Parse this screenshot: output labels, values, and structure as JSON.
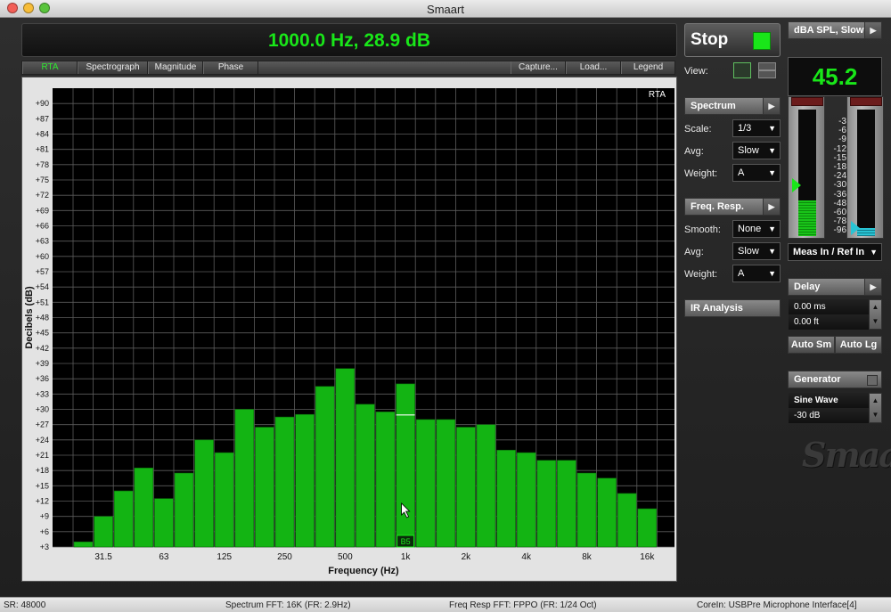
{
  "window": {
    "title": "Smaart"
  },
  "readout": {
    "text": "1000.0 Hz, 28.9 dB"
  },
  "tabs": {
    "rta": "RTA",
    "spectrograph": "Spectrograph",
    "magnitude": "Magnitude",
    "phase": "Phase",
    "capture": "Capture...",
    "load": "Load...",
    "legend": "Legend"
  },
  "plot": {
    "corner_label": "RTA",
    "cursor_label": "B5"
  },
  "controls": {
    "stop_label": "Stop",
    "view_label": "View:",
    "spectrum_header": "Spectrum",
    "scale_label": "Scale:",
    "scale_value": "1/3",
    "avg_label": "Avg:",
    "avg_value": "Slow",
    "weight_label": "Weight:",
    "weight_value": "A",
    "freq_header": "Freq. Resp.",
    "smooth_label": "Smooth:",
    "smooth_value": "None",
    "fr_avg_label": "Avg:",
    "fr_avg_value": "Slow",
    "fr_weight_label": "Weight:",
    "fr_weight_value": "A",
    "ir_label": "IR Analysis"
  },
  "spl": {
    "header": "dBA SPL, Slow",
    "value": "45.2"
  },
  "meter": {
    "scale": [
      "-3",
      "-6",
      "-9",
      "-12",
      "-15",
      "-18",
      "-24",
      "-30",
      "-36",
      "-48",
      "-60",
      "-78",
      "-96"
    ],
    "input_select": "Meas In / Ref In",
    "meas_level": 0.28,
    "ref_level": 0.06
  },
  "delay": {
    "header": "Delay",
    "ms": "0.00 ms",
    "ft": "0.00 ft",
    "auto_sm": "Auto Sm",
    "auto_lg": "Auto Lg"
  },
  "generator": {
    "header": "Generator",
    "signal": "Sine Wave",
    "level": "-30 dB"
  },
  "logo": "Smaart",
  "status": {
    "sr": "SR: 48000",
    "spectrum": "Spectrum FFT: 16K (FR: 2.9Hz)",
    "freq": "Freq Resp FFT: FPPO (FR: 1/24 Oct)",
    "device": "CoreIn: USBPre Microphone Interface[4]"
  },
  "colors": {
    "accent": "#19e619",
    "bar": "#13b413",
    "plot_bg": "#000000",
    "grid": "#666666"
  },
  "chart_data": {
    "type": "bar",
    "ylabel": "Decibels (dB)",
    "xlabel": "Frequency (Hz)",
    "ylim": [
      3,
      93
    ],
    "yticks": [
      "+90",
      "+87",
      "+84",
      "+81",
      "+78",
      "+75",
      "+72",
      "+69",
      "+66",
      "+63",
      "+60",
      "+57",
      "+54",
      "+51",
      "+48",
      "+45",
      "+42",
      "+39",
      "+36",
      "+33",
      "+30",
      "+27",
      "+24",
      "+21",
      "+18",
      "+15",
      "+12",
      "+9",
      "+6",
      "+3"
    ],
    "xticks": [
      "31.5",
      "63",
      "125",
      "250",
      "500",
      "1k",
      "2k",
      "4k",
      "8k",
      "16k"
    ],
    "values": [
      4,
      9,
      14,
      18.5,
      12.5,
      17.5,
      24,
      21.5,
      30,
      26.5,
      28.5,
      29,
      34.5,
      38,
      31,
      29.5,
      35,
      28,
      28,
      26.5,
      27,
      22,
      21.5,
      20,
      20,
      17.5,
      16.5,
      13.5,
      10.5
    ],
    "grid": true,
    "cursor": {
      "freq": "1000.0 Hz",
      "level": 28.9
    }
  }
}
